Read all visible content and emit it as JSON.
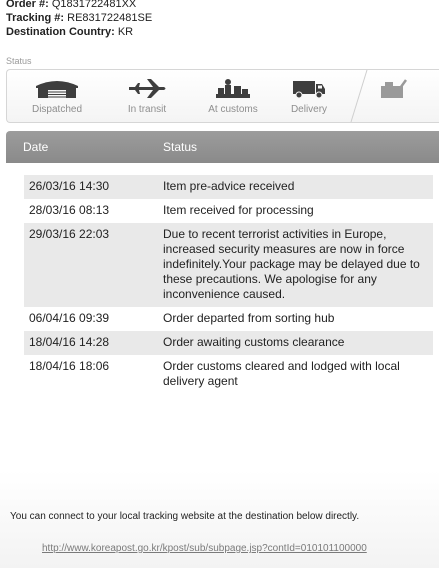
{
  "order": {
    "order_label": "Order #:",
    "order_value": "Q1831722481XX",
    "tracking_label": "Tracking #:",
    "tracking_value": "RE831722481SE",
    "country_label": "Destination Country:",
    "country_value": "KR"
  },
  "status_section": {
    "title": "Status",
    "steps": [
      {
        "label": "Dispatched",
        "icon": "warehouse-icon"
      },
      {
        "label": "In transit",
        "icon": "airplane-icon"
      },
      {
        "label": "At customs",
        "icon": "customs-icon"
      },
      {
        "label": "Delivery",
        "icon": "truck-icon"
      },
      {
        "label": "",
        "icon": "delivered-box-icon"
      }
    ]
  },
  "table": {
    "headers": {
      "date": "Date",
      "status": "Status"
    },
    "rows": [
      {
        "date": "26/03/16 14:30",
        "status": "Item pre-advice received"
      },
      {
        "date": "28/03/16 08:13",
        "status": "Item received for processing"
      },
      {
        "date": "29/03/16 22:03",
        "status": "Due to recent terrorist activities in Europe, increased security measures are now in force indefinitely.Your package may be delayed due to these precautions. We apologise for any inconvenience caused."
      },
      {
        "date": "06/04/16 09:39",
        "status": "Order departed from sorting hub"
      },
      {
        "date": "18/04/16 14:28",
        "status": "Order awaiting customs clearance"
      },
      {
        "date": "18/04/16 18:06",
        "status": "Order customs cleared and lodged with local delivery agent"
      }
    ]
  },
  "footer": {
    "connect_text": "You can connect to your local tracking website at the destination below directly.",
    "link_text": "http://www.koreapost.go.kr/kpost/sub/subpage.jsp?contId=010101100000"
  }
}
